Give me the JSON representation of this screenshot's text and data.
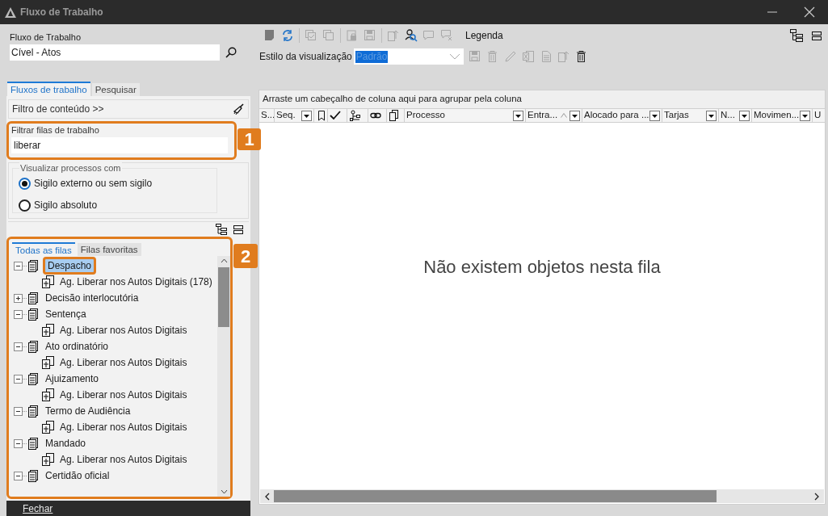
{
  "window": {
    "title": "Fluxo de Trabalho"
  },
  "workflow": {
    "label": "Fluxo de Trabalho",
    "value": "Cível - Atos"
  },
  "left_tabs": [
    {
      "label": "Fluxos de trabalho",
      "selected": true
    },
    {
      "label": "Pesquisar",
      "selected": false
    }
  ],
  "content_filter": {
    "label": "Filtro de conteúdo >>"
  },
  "queue_filter": {
    "label": "Filtrar filas de trabalho",
    "value": "liberar",
    "callout": "1"
  },
  "visibility": {
    "legend": "Visualizar processos com",
    "options": [
      {
        "label": "Sigilo externo ou sem sigilo",
        "selected": true
      },
      {
        "label": "Sigilo absoluto",
        "selected": false
      }
    ]
  },
  "queue_tabs": [
    {
      "label": "Todas as filas",
      "selected": true
    },
    {
      "label": "Filas favoritas",
      "selected": false
    }
  ],
  "tree_callout": "2",
  "tree": [
    {
      "label": "Despacho",
      "selected": true,
      "expanded": true,
      "children": [
        {
          "label": "Ag. Liberar nos Autos Digitais (178)"
        }
      ]
    },
    {
      "label": "Decisão interlocutória",
      "selected": false,
      "expanded": false
    },
    {
      "label": "Sentença",
      "selected": false,
      "expanded": true,
      "children": [
        {
          "label": "Ag. Liberar nos Autos Digitais"
        }
      ]
    },
    {
      "label": "Ato ordinatório",
      "selected": false,
      "expanded": true,
      "children": [
        {
          "label": "Ag. Liberar nos Autos Digitais"
        }
      ]
    },
    {
      "label": "Ajuizamento",
      "selected": false,
      "expanded": true,
      "children": [
        {
          "label": "Ag. Liberar nos Autos Digitais"
        }
      ]
    },
    {
      "label": "Termo de Audiência",
      "selected": false,
      "expanded": true,
      "children": [
        {
          "label": "Ag. Liberar nos Autos Digitais"
        }
      ]
    },
    {
      "label": "Mandado",
      "selected": false,
      "expanded": true,
      "children": [
        {
          "label": "Ag. Liberar nos Autos Digitais"
        }
      ]
    },
    {
      "label": "Certidão oficial",
      "selected": false,
      "expanded": true
    }
  ],
  "close_button": "Fechar",
  "toolbar": [
    {
      "kind": "note",
      "disabled": true
    },
    {
      "kind": "refresh",
      "disabled": false
    },
    {
      "kind": "sep"
    },
    {
      "kind": "checkcopy",
      "disabled": true
    },
    {
      "kind": "copy",
      "disabled": true
    },
    {
      "kind": "sep"
    },
    {
      "kind": "lock",
      "disabled": true
    },
    {
      "kind": "save",
      "disabled": true
    },
    {
      "kind": "sep"
    },
    {
      "kind": "export",
      "disabled": true
    },
    {
      "kind": "usersearch",
      "disabled": false
    },
    {
      "kind": "comment",
      "disabled": true
    },
    {
      "kind": "commentx",
      "disabled": true
    },
    {
      "kind": "label",
      "label": "Legenda",
      "disabled": false
    }
  ],
  "view_style": {
    "label": "Estilo da visualização",
    "value": "Padrão"
  },
  "view_tools": [
    {
      "kind": "save",
      "disabled": true
    },
    {
      "kind": "trash",
      "disabled": true
    },
    {
      "kind": "pencil",
      "disabled": true
    },
    {
      "kind": "excel",
      "disabled": true
    },
    {
      "kind": "doc",
      "disabled": true
    },
    {
      "kind": "export",
      "disabled": true
    },
    {
      "kind": "trash",
      "disabled": false
    }
  ],
  "grid": {
    "group_hint": "Arraste um cabeçalho de coluna aqui para agrupar pela coluna",
    "columns": [
      {
        "kind": "text",
        "label": "S...",
        "filter": false,
        "sorted": false
      },
      {
        "kind": "text",
        "label": "Seq.",
        "filter": true,
        "sorted": false
      },
      {
        "kind": "bookmark"
      },
      {
        "kind": "check"
      },
      {
        "kind": "hierarchy"
      },
      {
        "kind": "link"
      },
      {
        "kind": "docs"
      },
      {
        "kind": "text",
        "label": "Processo",
        "filter": true,
        "sorted": false
      },
      {
        "kind": "text",
        "label": "Entra...",
        "filter": true,
        "sorted": true
      },
      {
        "kind": "text",
        "label": "Alocado para ...",
        "filter": true,
        "sorted": false
      },
      {
        "kind": "text",
        "label": "Tarjas",
        "filter": true,
        "sorted": false
      },
      {
        "kind": "text",
        "label": "N...",
        "filter": true,
        "sorted": false
      },
      {
        "kind": "text",
        "label": "Movimen...",
        "filter": true,
        "sorted": false
      },
      {
        "kind": "text",
        "label": "U",
        "filter": false,
        "sorted": false
      }
    ],
    "empty_message": "Não existem objetos nesta fila"
  }
}
